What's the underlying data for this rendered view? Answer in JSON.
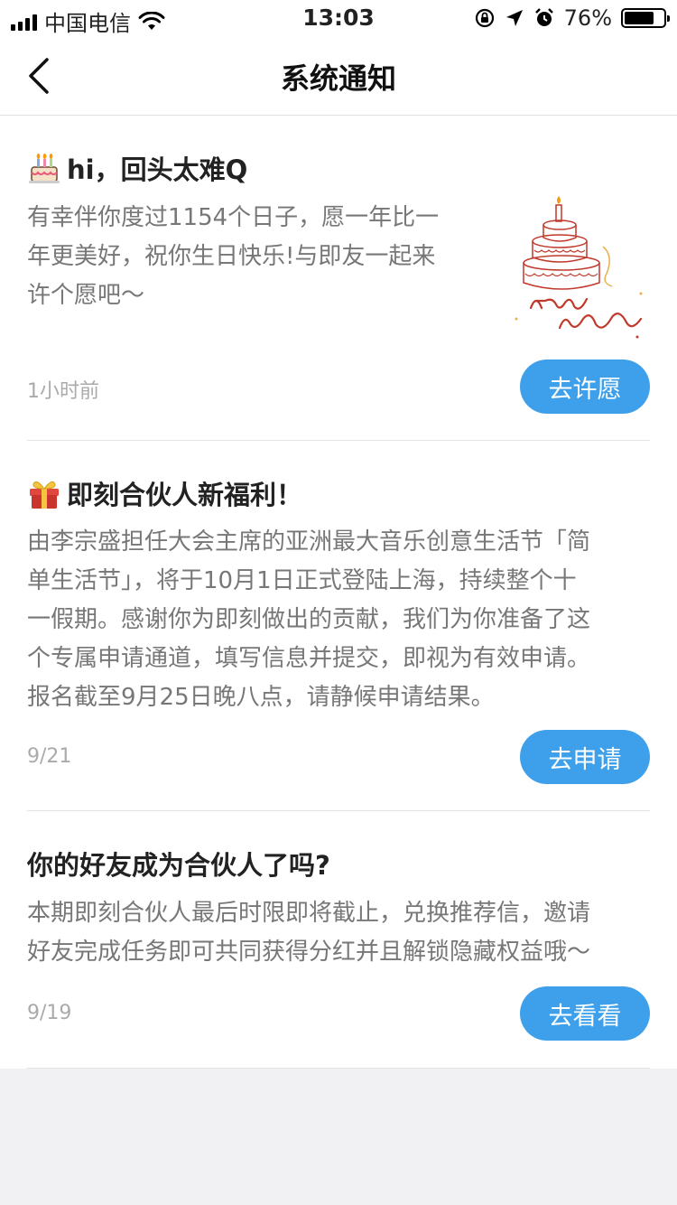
{
  "status_bar": {
    "carrier": "中国电信",
    "time": "13:03",
    "battery_percent": "76%",
    "battery_level": 0.76
  },
  "nav": {
    "title": "系统通知"
  },
  "notifications": [
    {
      "icon": "birthday-cake-icon",
      "title": "hi，回头太难Q",
      "body": [
        "有幸伴你度过1154个日子，愿一年比一",
        "年更美好，祝你生日快乐!与即友一起来",
        "许个愿吧～"
      ],
      "time": "1小时前",
      "button": "去许愿",
      "image": "happy-birthday-cake-illustration"
    },
    {
      "icon": "gift-box-icon",
      "title": "即刻合伙人新福利！",
      "body": [
        "由李宗盛担任大会主席的亚洲最大音乐创意生活节「简",
        "单生活节」，将于10月1日正式登陆上海，持续整个十",
        "一假期。感谢你为即刻做出的贡献，我们为你准备了这",
        "个专属申请通道，填写信息并提交，即视为有效申请。",
        "报名截至9月25日晚八点，请静候申请结果。"
      ],
      "time": "9/21",
      "button": "去申请"
    },
    {
      "title": "你的好友成为合伙人了吗?",
      "body": [
        "本期即刻合伙人最后时限即将截止，兑换推荐信，邀请",
        "好友完成任务即可共同获得分红并且解锁隐藏权益哦～"
      ],
      "time": "9/19",
      "button": "去看看"
    }
  ],
  "colors": {
    "accent": "#3ea0ea",
    "body_text": "#777777",
    "time_text": "#aaaaaa",
    "page_bg": "#f1f1f3"
  }
}
